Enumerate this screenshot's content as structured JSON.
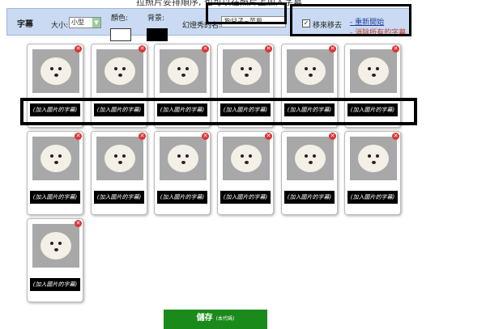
{
  "top_text": "拉照片妥排順序, 也可以在照片上加入字幕",
  "toolbar": {
    "title": "字幕",
    "size_label": "大小:",
    "size_value": "小型",
    "color_label": "顏色:",
    "background_label": "背景:",
    "name_label": "幻燈秀的名:",
    "name_value": "狗兒子~菜恩",
    "remove_ad_label": "移來移去",
    "restart_link": "- 重新開始",
    "delete_all_link": "- 消除所有的字幕"
  },
  "photos": [
    {
      "caption": "(加入圖片的字幕)"
    },
    {
      "caption": "(加入圖片的字幕)"
    },
    {
      "caption": "(加入圖片的字幕)"
    },
    {
      "caption": "(加入圖片的字幕)"
    },
    {
      "caption": "(加入圖片的字幕)"
    },
    {
      "caption": "(加入圖片的字幕)"
    },
    {
      "caption": "(加入圖片的字幕)"
    },
    {
      "caption": "(加入圖片的字幕)"
    },
    {
      "caption": "(加入圖片的字幕)"
    },
    {
      "caption": "(加入圖片的字幕)"
    },
    {
      "caption": "(加入圖片的字幕)"
    },
    {
      "caption": "(加入圖片的字幕)"
    },
    {
      "caption": "(加入圖片的字幕)"
    }
  ],
  "save_button": {
    "label": "儲存",
    "sub_label": "(本代碼)"
  },
  "colors": {
    "toolbar_bg": "#c9daf2",
    "save_bg": "#1a8a1a",
    "caption_bg": "#000000",
    "remove_icon": "#dd3333"
  }
}
